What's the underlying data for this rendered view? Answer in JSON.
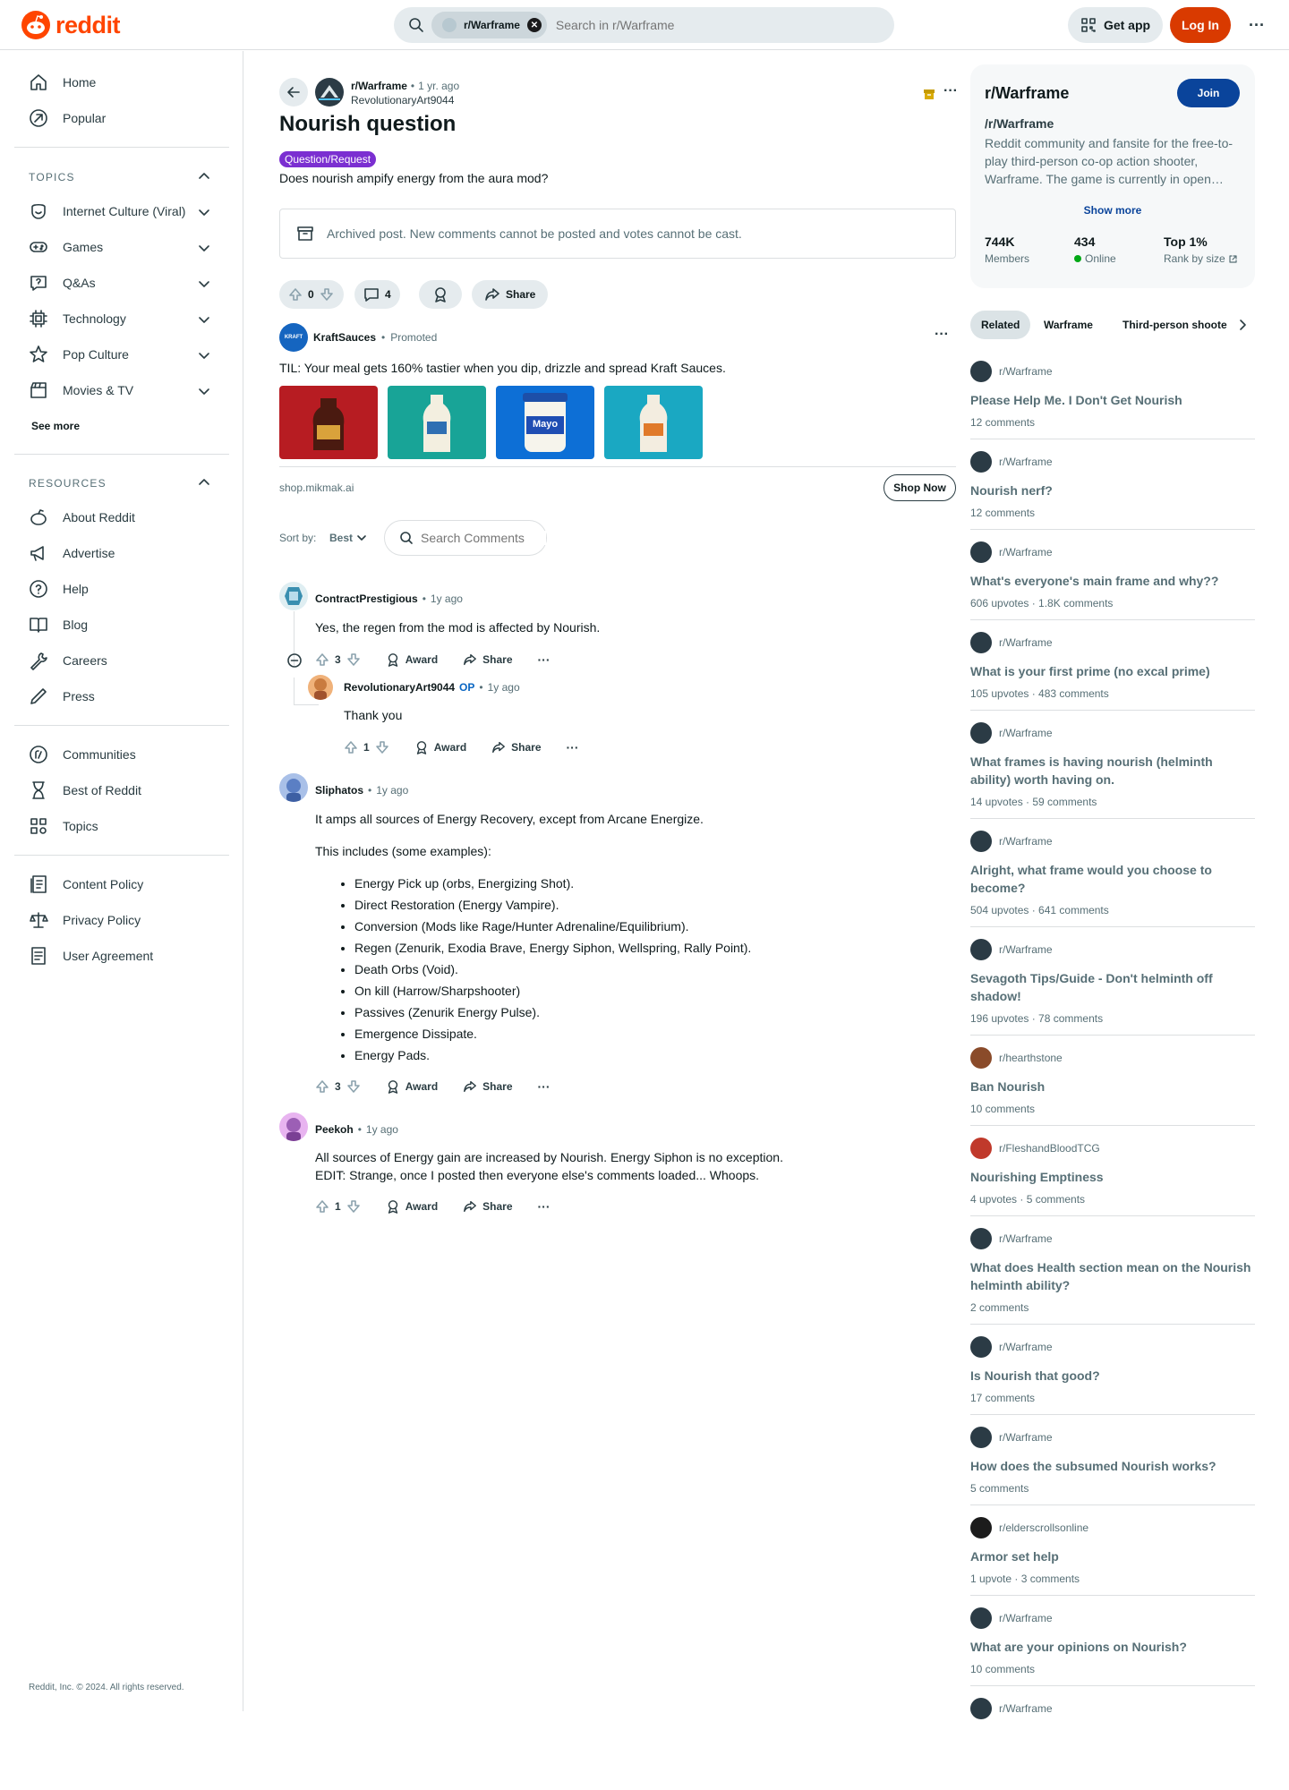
{
  "header": {
    "logo_text": "reddit",
    "search_chip": "r/Warframe",
    "search_placeholder": "Search in r/Warframe",
    "get_app": "Get app",
    "login": "Log In",
    "more": "···"
  },
  "sidebar": {
    "home": "Home",
    "popular": "Popular",
    "topics_heading": "TOPICS",
    "topics": [
      "Internet Culture (Viral)",
      "Games",
      "Q&As",
      "Technology",
      "Pop Culture",
      "Movies & TV"
    ],
    "see_more": "See more",
    "resources_heading": "RESOURCES",
    "resources": [
      "About Reddit",
      "Advertise",
      "Help",
      "Blog",
      "Careers",
      "Press"
    ],
    "more_links": [
      "Communities",
      "Best of Reddit",
      "Topics"
    ],
    "policies": [
      "Content Policy",
      "Privacy Policy",
      "User Agreement"
    ],
    "footer": "Reddit, Inc. © 2024. All rights reserved."
  },
  "post": {
    "subreddit": "r/Warframe",
    "time": "1 yr. ago",
    "author": "RevolutionaryArt9044",
    "title": "Nourish question",
    "flair": "Question/Request",
    "body": "Does nourish ampify energy from the aura mod?",
    "archived": "Archived post. New comments cannot be posted and votes cannot be cast.",
    "votes": "0",
    "comments": "4",
    "share": "Share"
  },
  "ad": {
    "advertiser": "KraftSauces",
    "promoted": "Promoted",
    "text": "TIL: Your meal gets 160% tastier when you dip, drizzle and spread Kraft Sauces.",
    "domain": "shop.mikmak.ai",
    "cta": "Shop Now",
    "logo_text": "KRAFT",
    "mayo_label": "Mayo",
    "image_colors": [
      "#b71c22",
      "#18a497",
      "#0d6fd6",
      "#1aa8c2"
    ]
  },
  "sort": {
    "label": "Sort by:",
    "value": "Best",
    "search_placeholder": "Search Comments"
  },
  "comments": [
    {
      "author": "ContractPrestigious",
      "time": "1y ago",
      "text": "Yes, the regen from the mod is affected by Nourish.",
      "votes": "3",
      "award": "Award",
      "share": "Share"
    },
    {
      "author": "RevolutionaryArt9044",
      "op": "OP",
      "time": "1y ago",
      "text": "Thank you",
      "votes": "1",
      "award": "Award",
      "share": "Share"
    },
    {
      "author": "Sliphatos",
      "time": "1y ago",
      "text": "It amps all sources of Energy Recovery, except from Arcane Energize.",
      "text2": "This includes (some examples):",
      "list": [
        "Energy Pick up (orbs, Energizing Shot).",
        "Direct Restoration (Energy Vampire).",
        "Conversion (Mods like Rage/Hunter Adrenaline/Equilibrium).",
        "Regen (Zenurik, Exodia Brave, Energy Siphon, Wellspring, Rally Point).",
        "Death Orbs (Void).",
        "On kill (Harrow/Sharpshooter)",
        "Passives (Zenurik Energy Pulse).",
        "Emergence Dissipate.",
        "Energy Pads."
      ],
      "votes": "3",
      "award": "Award",
      "share": "Share"
    },
    {
      "author": "Peekoh",
      "time": "1y ago",
      "text": "All sources of Energy gain are increased by Nourish. Energy Siphon is no exception.",
      "text2": "EDIT: Strange, once I posted then everyone else's comments loaded... Whoops.",
      "votes": "1",
      "award": "Award",
      "share": "Share"
    }
  ],
  "community": {
    "name": "r/Warframe",
    "join": "Join",
    "title": "/r/Warframe",
    "description": "Reddit community and fansite for the free-to-play third-person co-op action shooter, Warframe. The game is currently in open…",
    "show_more": "Show more",
    "members": "744K",
    "members_label": "Members",
    "online": "434",
    "online_label": "Online",
    "rank": "Top 1%",
    "rank_label": "Rank by size"
  },
  "related_tabs": [
    "Related",
    "Warframe",
    "Third-person shoote"
  ],
  "related": [
    {
      "sub": "r/Warframe",
      "title": "Please Help Me. I Don't Get Nourish",
      "stats": "12 comments",
      "color": "#2b3b45"
    },
    {
      "sub": "r/Warframe",
      "title": "Nourish nerf?",
      "stats": "12 comments",
      "color": "#2b3b45"
    },
    {
      "sub": "r/Warframe",
      "title": "What's everyone's main frame and why??",
      "stats": "606 upvotes · 1.8K comments",
      "color": "#2b3b45"
    },
    {
      "sub": "r/Warframe",
      "title": "What is your first prime (no excal prime)",
      "stats": "105 upvotes · 483 comments",
      "color": "#2b3b45"
    },
    {
      "sub": "r/Warframe",
      "title": "What frames is having nourish (helminth ability) worth having on.",
      "stats": "14 upvotes · 59 comments",
      "color": "#2b3b45"
    },
    {
      "sub": "r/Warframe",
      "title": "Alright, what frame would you choose to become?",
      "stats": "504 upvotes · 641 comments",
      "color": "#2b3b45"
    },
    {
      "sub": "r/Warframe",
      "title": "Sevagoth Tips/Guide - Don't helminth off shadow!",
      "stats": "196 upvotes · 78 comments",
      "color": "#2b3b45"
    },
    {
      "sub": "r/hearthstone",
      "title": "Ban Nourish",
      "stats": "10 comments",
      "color": "#8a4b2a"
    },
    {
      "sub": "r/FleshandBloodTCG",
      "title": "Nourishing Emptiness",
      "stats": "4 upvotes · 5 comments",
      "color": "#c0392b"
    },
    {
      "sub": "r/Warframe",
      "title": "What does Health section mean on the Nourish helminth ability?",
      "stats": "2 comments",
      "color": "#2b3b45"
    },
    {
      "sub": "r/Warframe",
      "title": "Is Nourish that good?",
      "stats": "17 comments",
      "color": "#2b3b45"
    },
    {
      "sub": "r/Warframe",
      "title": "How does the subsumed Nourish works?",
      "stats": "5 comments",
      "color": "#2b3b45"
    },
    {
      "sub": "r/elderscrollsonline",
      "title": "Armor set help",
      "stats": "1 upvote · 3 comments",
      "color": "#1c1c1c"
    },
    {
      "sub": "r/Warframe",
      "title": "What are your opinions on Nourish?",
      "stats": "10 comments",
      "color": "#2b3b45"
    },
    {
      "sub": "r/Warframe",
      "title": "",
      "stats": "",
      "color": "#2b3b45"
    }
  ],
  "colors": {
    "brand": "#ff4500",
    "join": "#0a449b",
    "flair": "#7b2fd1",
    "online": "#01a816",
    "op": "#0a66c2"
  }
}
